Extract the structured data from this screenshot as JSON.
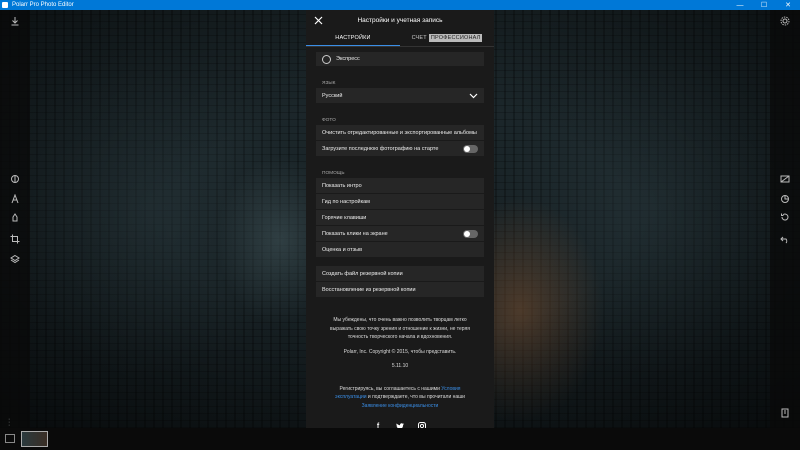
{
  "window": {
    "title": "Polarr Pro Photo Editor",
    "controls": [
      "—",
      "☐",
      "✕"
    ]
  },
  "panel": {
    "title": "Настройки и учетная запись",
    "tabs": [
      {
        "label": "НАСТРОЙКИ",
        "active": true
      },
      {
        "label": "СЧЕТ",
        "badge": "ПРОФЕССИОНАЛ"
      }
    ],
    "express_label": "Экспресс",
    "language": {
      "section": "ЯЗЫК",
      "selected": "Русский"
    },
    "photo": {
      "section": "ФОТО",
      "clear_albums": "Очистить отредактированные и экспортированные альбомы",
      "load_last": "Загрузите последнюю фотографию на старте",
      "load_last_on": false
    },
    "help": {
      "section": "ПОМОЩЬ",
      "items": [
        "Показать интро",
        "Гид по настройкам",
        "Горячие клавиши",
        "Показать клики на экране",
        "Оценка и отзыв"
      ],
      "show_clicks_on": false
    },
    "backup": {
      "create": "Создать файл резервной копии",
      "restore": "Восстановление из резервной копии"
    },
    "about_text": "Мы убеждены, что очень важно позволить творцам легко выражать свою точку зрения и отношение к жизни, не теряя точность творческого начала и вдохновения.",
    "copyright": "Polarr, Inc. Copyright © 2015, чтобы представить.",
    "version": "5.11.10",
    "legal": {
      "prefix": "Регистрируясь, вы соглашаетесь с нашими ",
      "terms_link": "Условия эксплуатации",
      "middle": " и подтверждаете, что вы прочитали наши ",
      "privacy_link": "Заявление конфиденциальности"
    },
    "social": {
      "facebook": "f",
      "twitter": "t",
      "instagram": "◎"
    }
  },
  "icons": {
    "left_tools": [
      "download-icon",
      "adjust-icon",
      "text-icon",
      "retouch-icon",
      "crop-icon",
      "layers-icon"
    ],
    "right_tools": [
      "settings-icon",
      "compare-icon",
      "reset-icon",
      "undo-icon",
      "export-icon"
    ]
  },
  "colors": {
    "accent": "#3a8ee6",
    "titlebar": "#0078d7",
    "panel_bg": "#1a1a1a",
    "row_bg": "#262626"
  }
}
